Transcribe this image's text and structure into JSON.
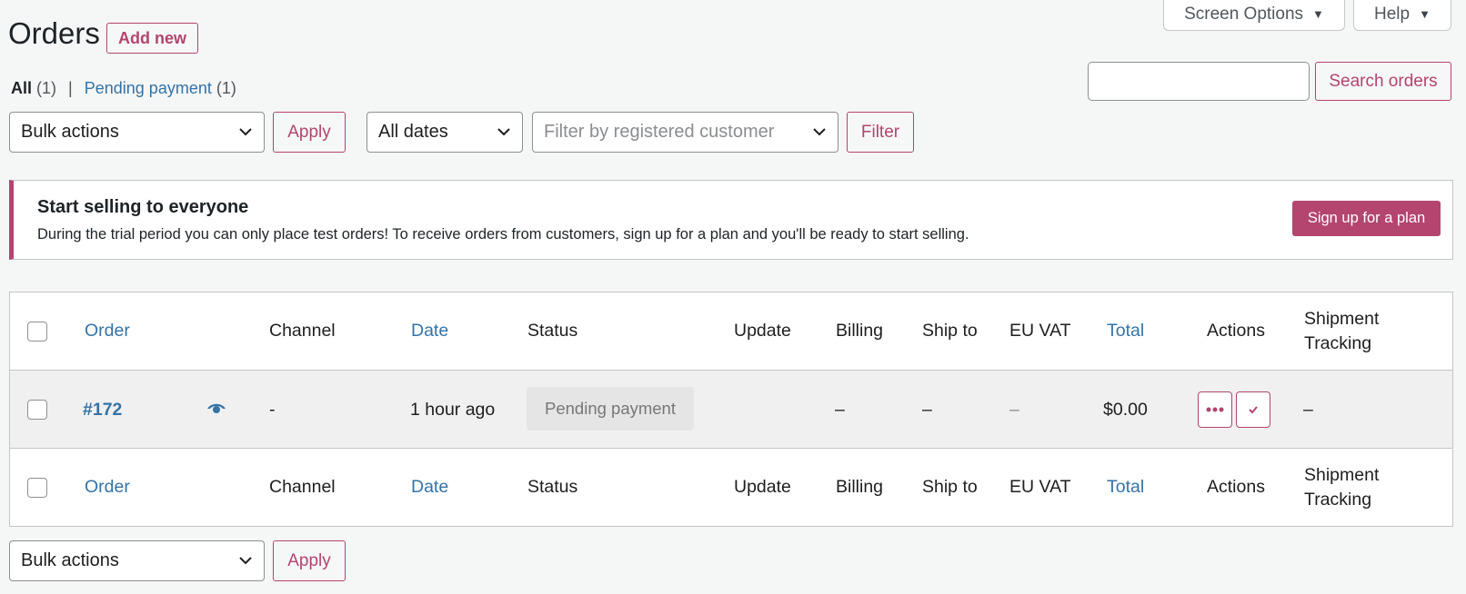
{
  "header": {
    "title": "Orders",
    "add_new": "Add new",
    "screen_options": "Screen Options",
    "help": "Help"
  },
  "filters_nav": {
    "all_label": "All",
    "all_count": "(1)",
    "separator": "|",
    "pending_label": "Pending payment",
    "pending_count": "(1)"
  },
  "search": {
    "value": "",
    "button": "Search orders"
  },
  "tablenav_top": {
    "bulk_actions": "Bulk actions",
    "apply": "Apply",
    "dates": "All dates",
    "customer_placeholder": "Filter by registered customer",
    "filter": "Filter"
  },
  "notice": {
    "title": "Start selling to everyone",
    "text": "During the trial period you can only place test orders! To receive orders from customers, sign up for a plan and you'll be ready to start selling.",
    "button": "Sign up for a plan"
  },
  "table": {
    "columns": {
      "order": "Order",
      "channel": "Channel",
      "date": "Date",
      "status": "Status",
      "update": "Update",
      "billing": "Billing",
      "ship_to": "Ship to",
      "eu_vat": "EU VAT",
      "total": "Total",
      "actions": "Actions",
      "shipment_1": "Shipment",
      "shipment_2": "Tracking"
    },
    "row": {
      "order": "#172",
      "channel": "-",
      "date": "1 hour ago",
      "status": "Pending payment",
      "update": "",
      "billing": "–",
      "ship_to": "–",
      "eu_vat": "–",
      "total": "$0.00",
      "shipment": "–"
    }
  },
  "tablenav_bottom": {
    "bulk_actions": "Bulk actions",
    "apply": "Apply"
  },
  "colors": {
    "accent": "#b3456f",
    "link": "#3473a6",
    "background": "#f5f6f6"
  },
  "icons": {
    "dropdown": "triangle-down-icon",
    "select": "chevron-down-icon",
    "preview": "eye-icon",
    "more": "ellipsis-icon",
    "complete": "checkmark-icon"
  }
}
